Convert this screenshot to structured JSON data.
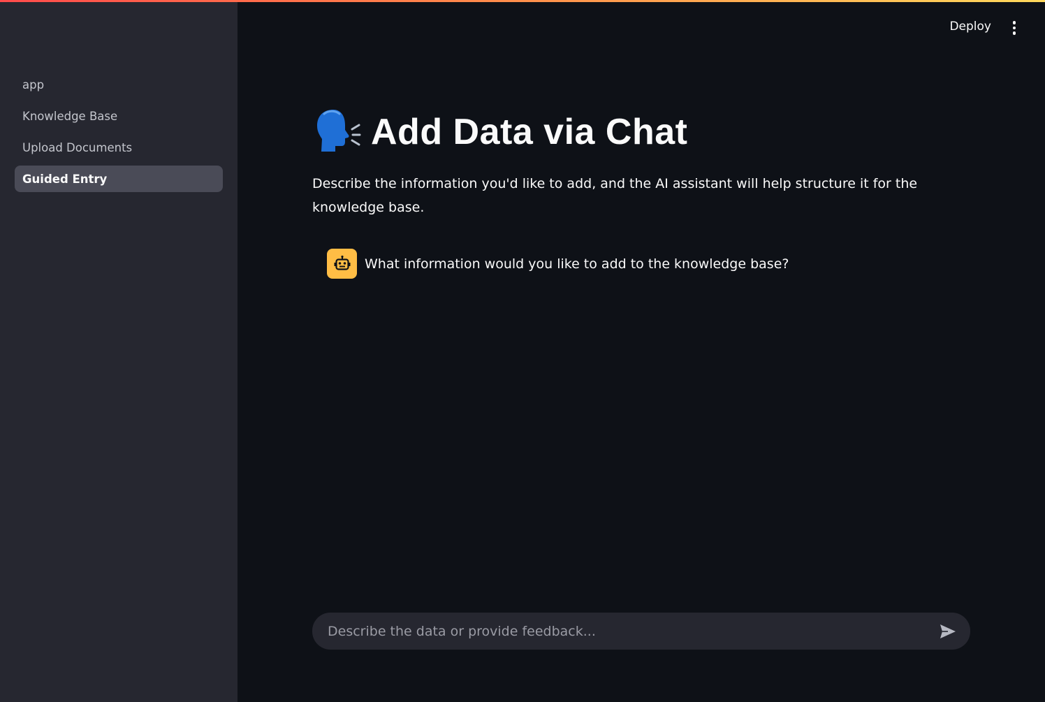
{
  "sidebar": {
    "items": [
      {
        "label": "app",
        "active": false
      },
      {
        "label": "Knowledge Base",
        "active": false
      },
      {
        "label": "Upload Documents",
        "active": false
      },
      {
        "label": "Guided Entry",
        "active": true
      }
    ]
  },
  "header": {
    "deploy_label": "Deploy",
    "menu_icon": "kebab-menu-icon"
  },
  "page": {
    "title_icon": "speaking-head-icon",
    "title": "Add Data via Chat",
    "description": "Describe the information you'd like to add, and the AI assistant will help structure it for the knowledge base."
  },
  "chat": {
    "messages": [
      {
        "role": "assistant",
        "avatar_icon": "robot-icon",
        "text": "What information would you like to add to the knowledge base?"
      }
    ],
    "input": {
      "value": "",
      "placeholder": "Describe the data or provide feedback...",
      "send_icon": "send-icon"
    }
  },
  "colors": {
    "background": "#0e1117",
    "sidebar": "#262730",
    "active_nav": "#4a4b57",
    "assistant_avatar": "#ffbd45",
    "accent_gradient_start": "#ff4b4b",
    "accent_gradient_end": "#ffd95c"
  }
}
